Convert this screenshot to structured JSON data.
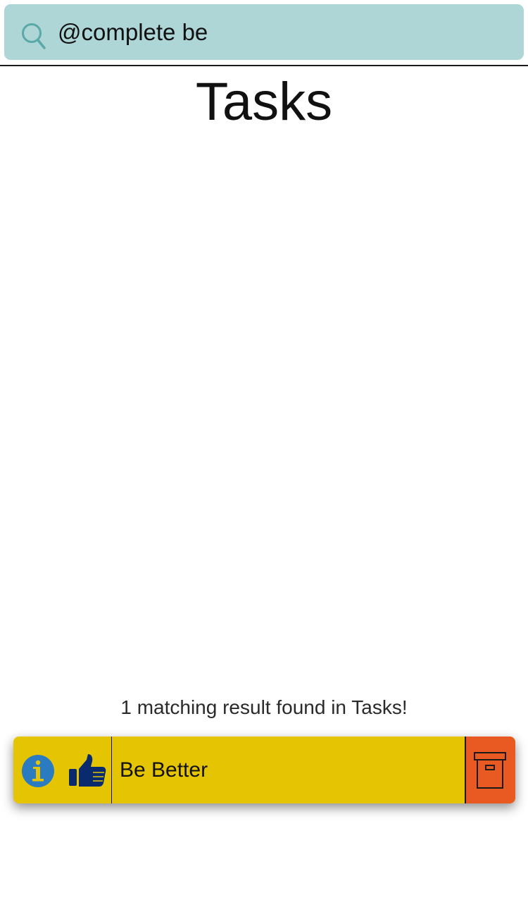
{
  "search": {
    "value": "@complete be",
    "icon": "search-icon"
  },
  "header": {
    "title": "Tasks"
  },
  "results": {
    "summary": "1 matching result found in Tasks!"
  },
  "tasks": [
    {
      "title": "Be Better",
      "icons": [
        "info-icon",
        "thumbs-up-icon",
        "archive-icon"
      ]
    }
  ],
  "colors": {
    "search_bg": "#aed6d6",
    "search_icon": "#5aa8a8",
    "task_bg": "#e5c404",
    "info_icon": "#2b7bc0",
    "thumbs_up": "#0a2a6e",
    "archive_bg": "#e85a22"
  }
}
